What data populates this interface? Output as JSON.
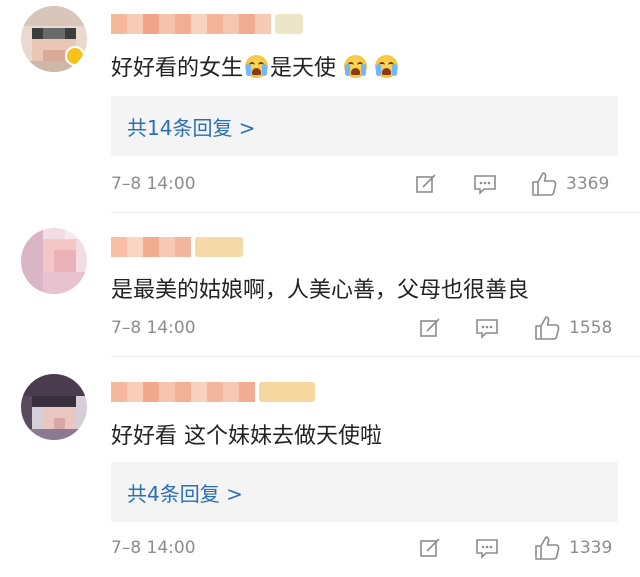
{
  "comments": [
    {
      "text": "好好看的女生",
      "text2": "是天使",
      "emojis": [
        "crying-emoji",
        "crying-emoji",
        "crying-emoji"
      ],
      "replies_label": "共14条回复 >",
      "time": "7–8 14:00",
      "likes": "3369"
    },
    {
      "text": "是最美的姑娘啊，人美心善，父母也很善良",
      "time": "7–8 14:00",
      "likes": "1558"
    },
    {
      "text": "好好看 这个妹妹去做天使啦",
      "replies_label": "共4条回复 >",
      "time": "7–8 14:00",
      "likes": "1339"
    }
  ],
  "icons": {
    "repost": "repost-icon",
    "comment": "comment-icon",
    "like": "thumbs-up-icon"
  },
  "colors": {
    "link": "#2a6fb5",
    "meta": "#8c8c8c",
    "reply_bg": "#f4f4f4"
  }
}
